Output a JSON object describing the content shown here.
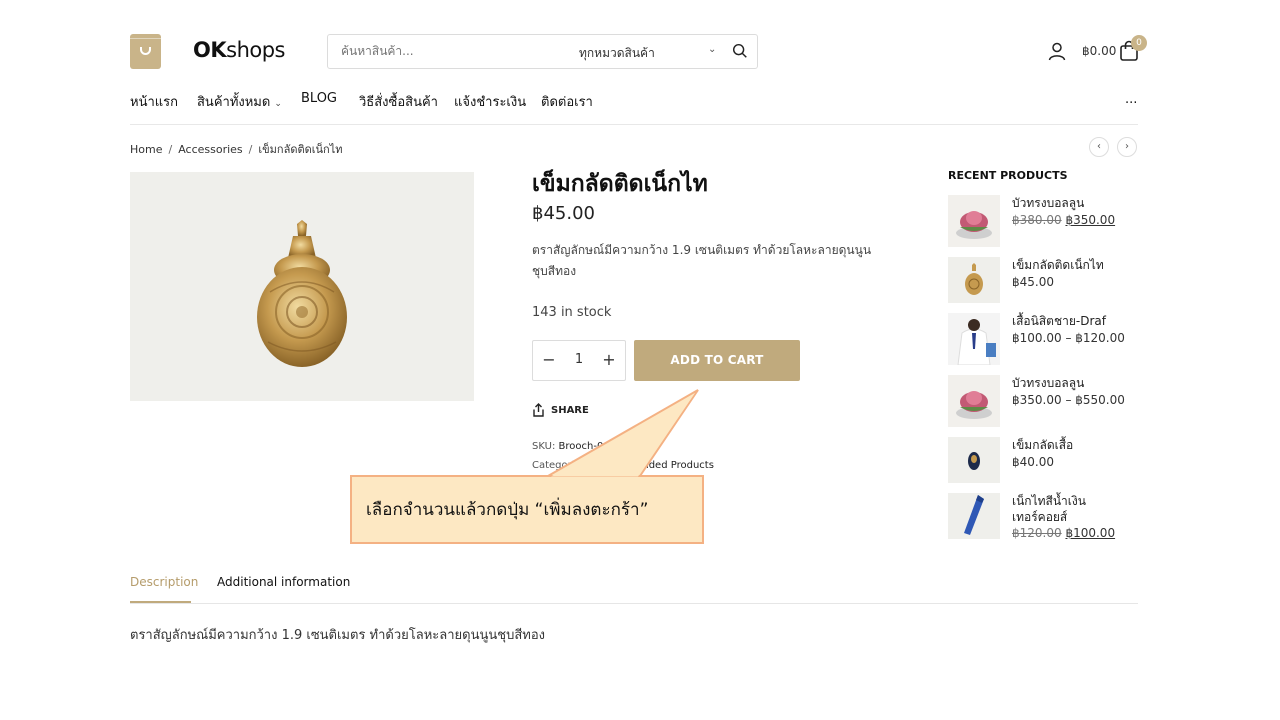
{
  "header": {
    "logo_bold": "OK",
    "logo_rest": "shops",
    "search_placeholder": "ค้นหาสินค้า...",
    "search_category": "ทุกหมวดสินค้า",
    "cart_total": "฿0.00",
    "cart_count": "0"
  },
  "nav": {
    "items": [
      {
        "label": "หน้าแรก"
      },
      {
        "label": "สินค้าทั้งหมด"
      },
      {
        "label": "BLOG"
      },
      {
        "label": "วิธีสั่งซื้อสินค้า"
      },
      {
        "label": "แจ้งชำระเงิน"
      },
      {
        "label": "ติดต่อเรา"
      }
    ],
    "more": "..."
  },
  "breadcrumb": {
    "items": [
      "Home",
      "Accessories",
      "เข็มกลัดติดเน็กไท"
    ],
    "separator": "/"
  },
  "pager": {
    "prev": "‹",
    "next": "›"
  },
  "product": {
    "title": "เข็มกลัดติดเน็กไท",
    "price": "฿45.00",
    "short_description": "ตราสัญลักษณ์มีความกว้าง 1.9 เซนติเมตร ทำด้วยโลหะลายดุนนูนชุบสีทอง",
    "stock": "143 in stock",
    "quantity": "1",
    "add_to_cart_label": "ADD TO CART",
    "share_label": "SHARE",
    "sku_label": "SKU:",
    "sku_value": "Brooch-001",
    "category_label": "Categories:",
    "category_value": "Recommended Products"
  },
  "callout": {
    "text": "เลือกจำนวนแล้วกดปุ่ม  “เพิ่มลงตะกร้า”",
    "fill_color": "#fde8c3",
    "border_color": "#f4b183"
  },
  "recent_products": {
    "title": "RECENT PRODUCTS",
    "items": [
      {
        "name": "บัวทรงบอลลูน",
        "old_price": "฿380.00",
        "price": "฿350.00",
        "thumb": "lotus"
      },
      {
        "name": "เข็มกลัดติดเน็กไท",
        "price": "฿45.00",
        "thumb": "brooch"
      },
      {
        "name": "เสื้อนิสิตชาย-Draf",
        "price": "฿100.00 – ฿120.00",
        "thumb": "shirt"
      },
      {
        "name": "บัวทรงบอลลูน",
        "price": "฿350.00 – ฿550.00",
        "thumb": "lotus"
      },
      {
        "name": "เข็มกลัดเสื้อ",
        "price": "฿40.00",
        "thumb": "pin"
      },
      {
        "name": "เน็กไทสีน้ำเงิน",
        "name2": "เทอร์คอยส์",
        "old_price": "฿120.00",
        "price": "฿100.00",
        "thumb": "tie"
      }
    ]
  },
  "tabs": {
    "items": [
      {
        "label": "Description"
      },
      {
        "label": "Additional information"
      }
    ],
    "active": "Description"
  },
  "description": "ตราสัญลักษณ์มีความกว้าง 1.9 เซนติเมตร ทำด้วยโลหะลายดุนนูนชุบสีทอง",
  "colors": {
    "accent": "#c0aa7d",
    "brand": "#c9b489"
  }
}
